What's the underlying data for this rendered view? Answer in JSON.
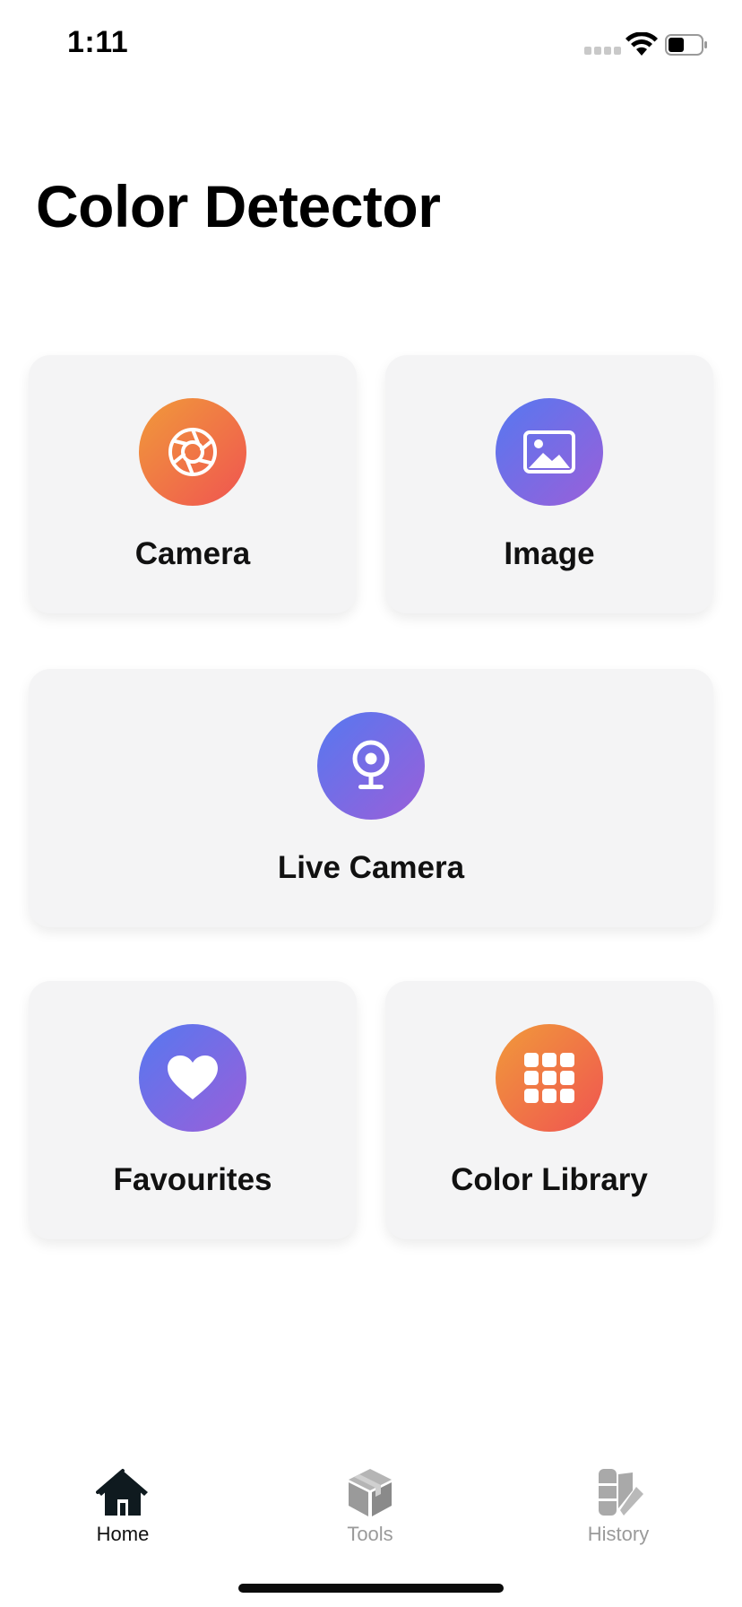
{
  "status_bar": {
    "time": "1:11"
  },
  "title": "Color Detector",
  "cards": {
    "camera": {
      "label": "Camera",
      "icon": "aperture-icon",
      "gradient": [
        "#f19a3a",
        "#ef5451"
      ]
    },
    "image": {
      "label": "Image",
      "icon": "image-icon",
      "gradient": [
        "#5678f0",
        "#9a5fd9"
      ]
    },
    "live_camera": {
      "label": "Live Camera",
      "icon": "webcam-icon",
      "gradient": [
        "#5678f0",
        "#9a5fd9"
      ]
    },
    "favourites": {
      "label": "Favourites",
      "icon": "heart-icon",
      "gradient": [
        "#5678f0",
        "#9a5fd9"
      ]
    },
    "color_library": {
      "label": "Color Library",
      "icon": "grid-icon",
      "gradient": [
        "#f19a3a",
        "#ef5451"
      ]
    }
  },
  "tab_bar": {
    "home": {
      "label": "Home",
      "icon": "house-icon",
      "active": true
    },
    "tools": {
      "label": "Tools",
      "icon": "box-icon",
      "active": false
    },
    "history": {
      "label": "History",
      "icon": "swatch-icon",
      "active": false
    }
  },
  "colors": {
    "card_bg": "#f4f4f5",
    "active_tab": "#111111",
    "inactive_tab": "#9a9a9a"
  }
}
